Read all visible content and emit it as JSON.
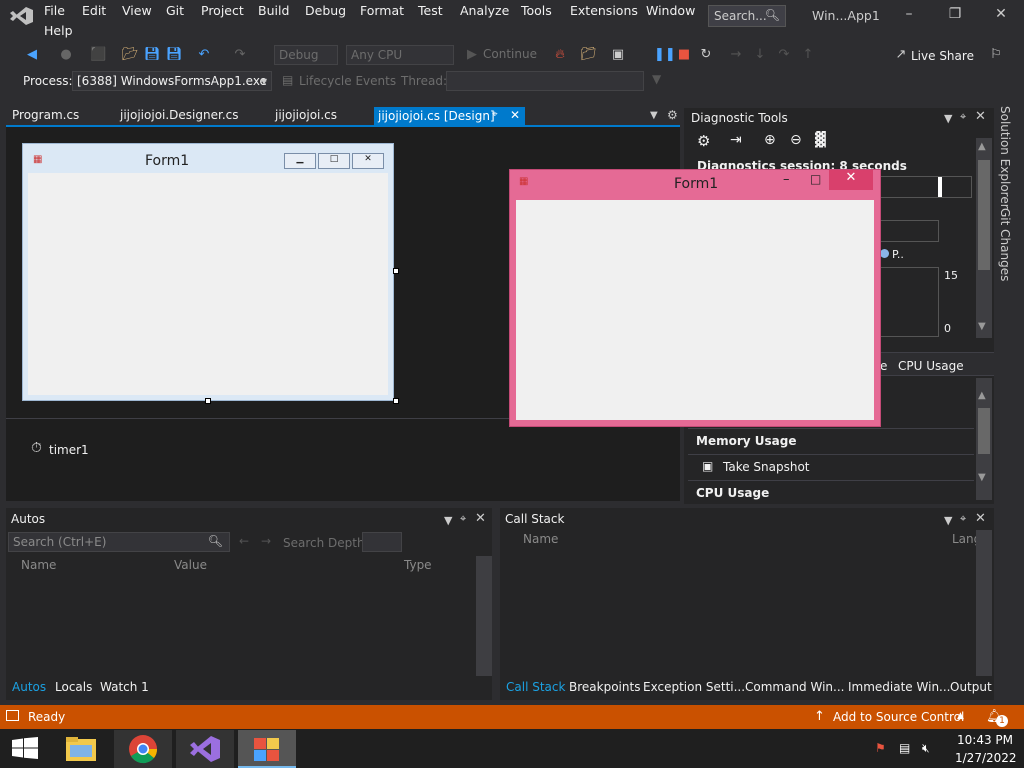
{
  "menu": {
    "items": [
      "File",
      "Edit",
      "View",
      "Git",
      "Project",
      "Build",
      "Debug",
      "Format",
      "Test",
      "Analyze",
      "Tools",
      "Extensions",
      "Window",
      "Help"
    ],
    "search_placeholder": "Search...",
    "window_title": "Win...App1"
  },
  "toolbar": {
    "config": "Debug",
    "platform": "Any CPU",
    "continue_label": "Continue",
    "live_share": "Live Share",
    "process_label": "Process:",
    "process_value": "[6388] WindowsFormsApp1.exe",
    "lifecycle_label": "Lifecycle Events",
    "thread_label": "Thread:"
  },
  "tabs": {
    "items": [
      "Program.cs",
      "jijojiojoi.Designer.cs",
      "jijojiojoi.cs"
    ],
    "active": "jijojiojoi.cs [Design]"
  },
  "designer": {
    "form_title": "Form1",
    "tray_component": "timer1"
  },
  "running_form": {
    "title": "Form1"
  },
  "diagnostics": {
    "title": "Diagnostic Tools",
    "session": "Diagnostics session: 8 seconds",
    "legend_fragment": "P..",
    "axis_max": "15",
    "axis_min": "0",
    "tab_fragment": "e",
    "cpu_tab": "CPU Usage",
    "memory_usage": "Memory Usage",
    "take_snapshot": "Take Snapshot",
    "cpu_usage": "CPU Usage"
  },
  "side_tabs": [
    "Solution Explorer",
    "Git Changes"
  ],
  "autos": {
    "title": "Autos",
    "search_placeholder": "Search (Ctrl+E)",
    "search_depth": "Search Depth:",
    "columns": [
      "Name",
      "Value",
      "Type"
    ],
    "tabs": [
      "Autos",
      "Locals",
      "Watch 1"
    ]
  },
  "callstack": {
    "title": "Call Stack",
    "columns": [
      "Name",
      "Lang"
    ],
    "tabs": [
      "Call Stack",
      "Breakpoints",
      "Exception Setti...",
      "Command Win...",
      "Immediate Win...",
      "Output"
    ]
  },
  "status": {
    "text": "Ready",
    "source_control": "Add to Source Control",
    "notification_count": "1"
  },
  "taskbar": {
    "time": "10:43 PM",
    "date": "1/27/2022"
  },
  "colors": {
    "accent": "#007acc",
    "status_bar": "#ca5100",
    "pink_form": "#e56a95"
  }
}
